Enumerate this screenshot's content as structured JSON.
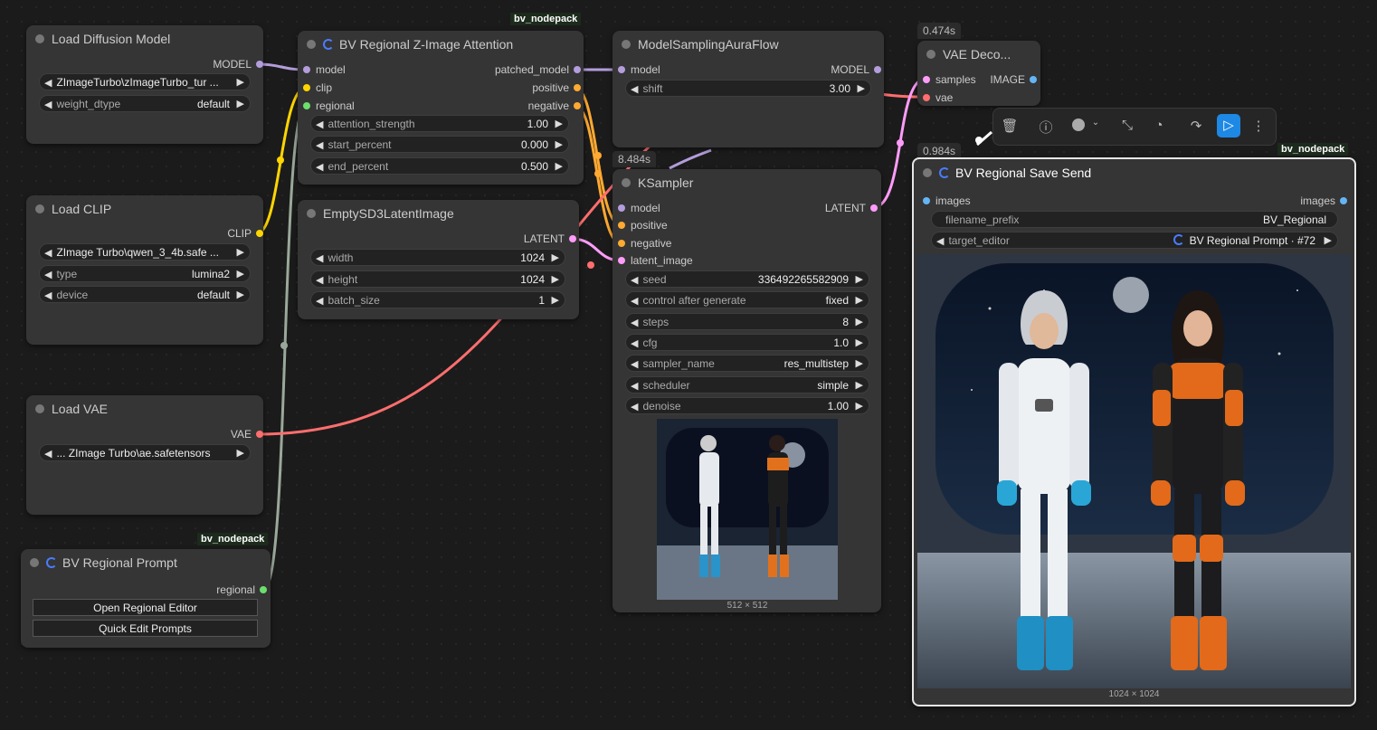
{
  "nodes": {
    "load_diffusion": {
      "title": "Load Diffusion Model",
      "out": "MODEL",
      "w_name": "ZImageTurbo\\zImageTurbo_tur ...",
      "w_dtype_label": "weight_dtype",
      "w_dtype_value": "default"
    },
    "load_clip": {
      "title": "Load CLIP",
      "out": "CLIP",
      "w_name": "ZImage Turbo\\qwen_3_4b.safe ...",
      "type_label": "type",
      "type_value": "lumina2",
      "device_label": "device",
      "device_value": "default"
    },
    "load_vae": {
      "title": "Load VAE",
      "out": "VAE",
      "w_name": "...  ZImage Turbo\\ae.safetensors"
    },
    "bv_prompt": {
      "title": "BV Regional Prompt",
      "pack": "bv_nodepack",
      "out": "regional",
      "btn_open": "Open Regional Editor",
      "btn_quick": "Quick Edit Prompts"
    },
    "bv_attention": {
      "title": "BV Regional Z-Image Attention",
      "pack": "bv_nodepack",
      "in_model": "model",
      "in_clip": "clip",
      "in_regional": "regional",
      "out_patched": "patched_model",
      "out_positive": "positive",
      "out_negative": "negative",
      "attn_label": "attention_strength",
      "attn_value": "1.00",
      "start_label": "start_percent",
      "start_value": "0.000",
      "end_label": "end_percent",
      "end_value": "0.500"
    },
    "empty_latent": {
      "title": "EmptySD3LatentImage",
      "out": "LATENT",
      "width_label": "width",
      "width_value": "1024",
      "height_label": "height",
      "height_value": "1024",
      "batch_label": "batch_size",
      "batch_value": "1"
    },
    "model_sampling": {
      "title": "ModelSamplingAuraFlow",
      "in": "model",
      "out": "MODEL",
      "shift_label": "shift",
      "shift_value": "3.00"
    },
    "ksampler": {
      "title": "KSampler",
      "timing": "8.484s",
      "in_model": "model",
      "in_positive": "positive",
      "in_negative": "negative",
      "in_latent": "latent_image",
      "out": "LATENT",
      "widgets": [
        {
          "label": "seed",
          "value": "336492265582909"
        },
        {
          "label": "control after generate",
          "value": "fixed"
        },
        {
          "label": "steps",
          "value": "8"
        },
        {
          "label": "cfg",
          "value": "1.0"
        },
        {
          "label": "sampler_name",
          "value": "res_multistep"
        },
        {
          "label": "scheduler",
          "value": "simple"
        },
        {
          "label": "denoise",
          "value": "1.00"
        }
      ],
      "preview_size": "512 × 512"
    },
    "vae_decode": {
      "title": "VAE Deco...",
      "timing": "0.474s",
      "in_samples": "samples",
      "in_vae": "vae",
      "out": "IMAGE"
    },
    "save_send": {
      "title": "BV Regional Save Send",
      "pack": "bv_nodepack",
      "timing": "0.984s",
      "in": "images",
      "out": "images",
      "prefix_label": "filename_prefix",
      "prefix_value": "BV_Regional",
      "editor_label": "target_editor",
      "editor_value": "BV Regional Prompt · #72",
      "image_size": "1024 × 1024"
    }
  },
  "toolbar": {
    "icons": [
      "trash-icon",
      "info-icon",
      "color-icon",
      "collapse-icon",
      "bypass-icon",
      "redo-icon",
      "run-icon",
      "more-icon"
    ]
  },
  "colors": {
    "model": "#b39ddb",
    "clip": "#ffd500",
    "conditioning": "#ffa931",
    "latent": "#ff9cf9",
    "vae": "#ff6e6e",
    "regional": "#6cdf6c",
    "image": "#64b5f6",
    "accent": "#1e88e5"
  }
}
